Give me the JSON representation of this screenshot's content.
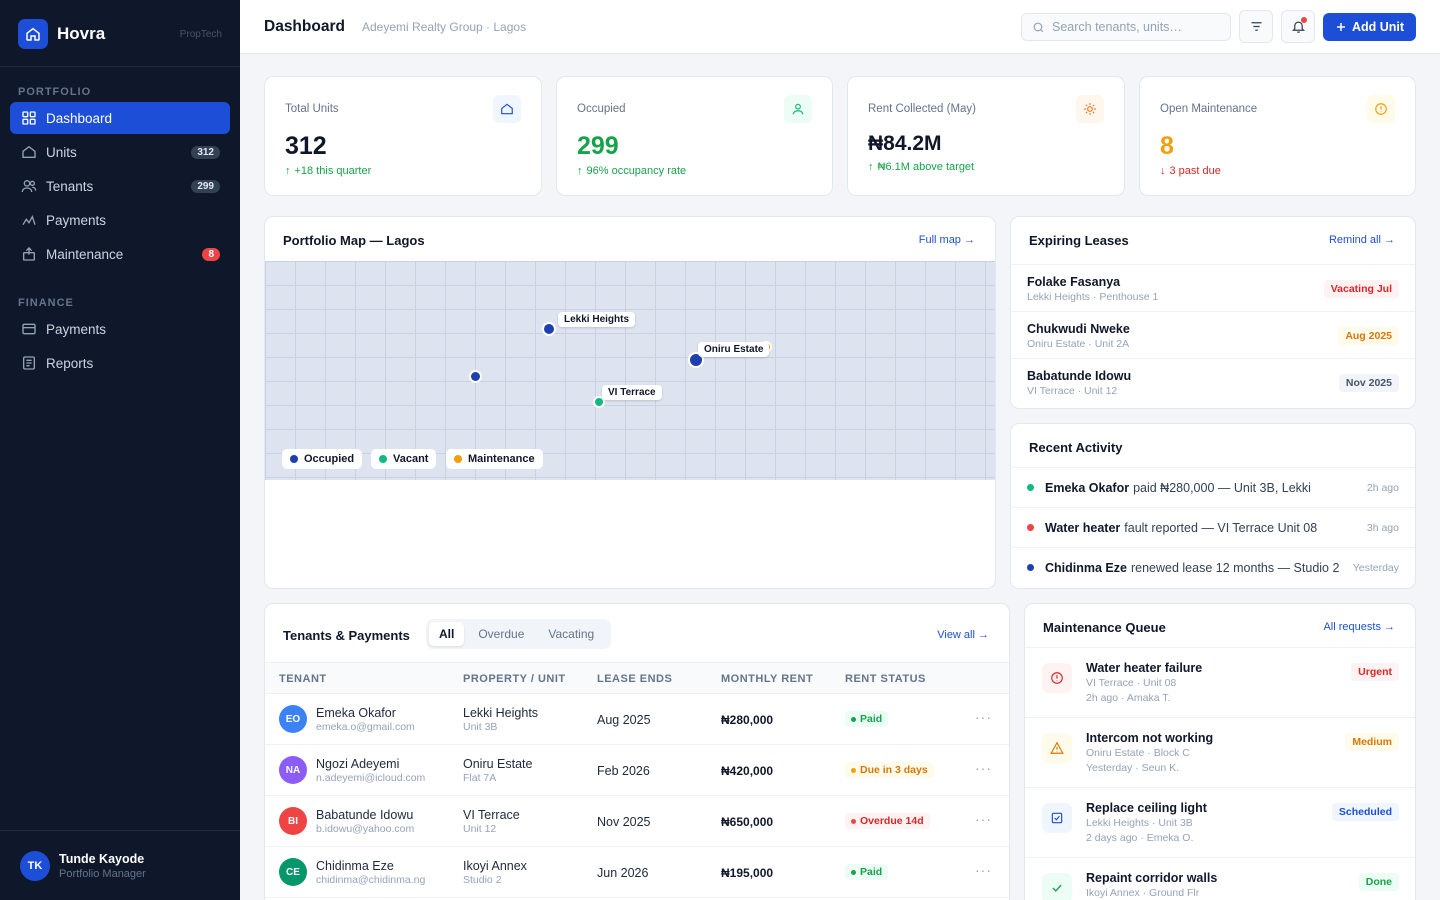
{
  "brand": {
    "name": "Hovra",
    "tag": "PropTech"
  },
  "sidebar": {
    "sections": [
      "PORTFOLIO",
      "FINANCE"
    ],
    "items": [
      {
        "label": "Dashboard",
        "icon": "grid-icon",
        "active": true
      },
      {
        "label": "Units",
        "icon": "home-icon",
        "badge": "312"
      },
      {
        "label": "Tenants",
        "icon": "users-icon",
        "badge": "299"
      },
      {
        "label": "Payments",
        "icon": "trend-icon"
      },
      {
        "label": "Maintenance",
        "icon": "toolbox-icon",
        "badge": "8"
      },
      {
        "label": "Payments",
        "icon": "card-icon"
      },
      {
        "label": "Reports",
        "icon": "report-icon"
      }
    ],
    "user": {
      "initials": "TK",
      "name": "Tunde Kayode",
      "role": "Portfolio Manager"
    }
  },
  "topbar": {
    "title": "Dashboard",
    "subtitle": "Adeyemi Realty Group · Lagos",
    "search_placeholder": "Search tenants, units…",
    "add_label": "Add Unit"
  },
  "stats": [
    {
      "label": "Total Units",
      "value": "312",
      "sub": "+18 this quarter",
      "color": "#0f172a",
      "sub_color": "#16a34a"
    },
    {
      "label": "Occupied",
      "value": "299",
      "sub": "96% occupancy rate",
      "color": "#16a34a",
      "sub_color": "#16a34a"
    },
    {
      "label": "Rent Collected (May)",
      "value": "₦84.2M",
      "sub": "₦6.1M above target",
      "color": "#0f172a",
      "sub_color": "#16a34a"
    },
    {
      "label": "Open Maintenance",
      "value": "8",
      "sub": "3 past due",
      "color": "#f59e0b",
      "sub_color": "#dc2626"
    }
  ],
  "map": {
    "title": "Portfolio Map — Lagos",
    "link": "Full map →",
    "labels": [
      "Lekki Heights",
      "Oniru Estate",
      "VI Terrace"
    ],
    "legend": [
      "Occupied",
      "Vacant",
      "Maintenance"
    ],
    "colors": {
      "occupied": "#1e40af",
      "vacant": "#10b981",
      "maintenance": "#f59e0b"
    }
  },
  "leases": {
    "title": "Expiring Leases",
    "link": "Remind all →",
    "items": [
      {
        "name": "Folake Fasanya",
        "sub": "Lekki Heights · Penthouse 1",
        "badge": "Vacating Jul"
      },
      {
        "name": "Chukwudi Nweke",
        "sub": "Oniru Estate · Unit 2A",
        "badge": "Aug 2025"
      },
      {
        "name": "Babatunde Idowu",
        "sub": "VI Terrace · Unit 12",
        "badge": "Nov 2025"
      }
    ]
  },
  "activity": {
    "title": "Recent Activity",
    "items": [
      {
        "who": "Emeka Okafor",
        "text": "paid ₦280,000 — Unit 3B, Lekki",
        "time": "2h ago"
      },
      {
        "who": "Water heater",
        "text": "fault reported — VI Terrace Unit 08",
        "time": "3h ago"
      },
      {
        "who": "Chidinma Eze",
        "text": "renewed lease 12 months — Studio 2",
        "time": "Yesterday"
      }
    ]
  },
  "tenants": {
    "title": "Tenants & Payments",
    "tabs": [
      "All",
      "Overdue",
      "Vacating"
    ],
    "link": "View all →",
    "columns": [
      "TENANT",
      "PROPERTY / UNIT",
      "LEASE ENDS",
      "MONTHLY RENT",
      "RENT STATUS"
    ],
    "rows": [
      {
        "initials": "EO",
        "name": "Emeka Okafor",
        "email": "emeka.o@gmail.com",
        "property": "Lekki Heights",
        "unit": "Unit 3B",
        "lease": "Aug 2025",
        "rent": "₦280,000",
        "status": "Paid"
      },
      {
        "initials": "NA",
        "name": "Ngozi Adeyemi",
        "email": "n.adeyemi@icloud.com",
        "property": "Oniru Estate",
        "unit": "Flat 7A",
        "lease": "Feb 2026",
        "rent": "₦420,000",
        "status": "Due in 3 days"
      },
      {
        "initials": "BI",
        "name": "Babatunde Idowu",
        "email": "b.idowu@yahoo.com",
        "property": "VI Terrace",
        "unit": "Unit 12",
        "lease": "Nov 2025",
        "rent": "₦650,000",
        "status": "Overdue 14d"
      },
      {
        "initials": "CE",
        "name": "Chidinma Eze",
        "email": "chidinma@chidinma.ng",
        "property": "Ikoyi Annex",
        "unit": "Studio 2",
        "lease": "Jun 2026",
        "rent": "₦195,000",
        "status": "Paid"
      }
    ],
    "more": "···"
  },
  "maintenance": {
    "title": "Maintenance Queue",
    "link": "All requests →",
    "items": [
      {
        "title": "Water heater failure",
        "sub": "VI Terrace · Unit 08",
        "meta": "2h ago · Amaka T.",
        "badge": "Urgent"
      },
      {
        "title": "Intercom not working",
        "sub": "Oniru Estate · Block C",
        "meta": "Yesterday · Seun K.",
        "badge": "Medium"
      },
      {
        "title": "Replace ceiling light",
        "sub": "Lekki Heights · Unit 3B",
        "meta": "2 days ago · Emeka O.",
        "badge": "Scheduled"
      },
      {
        "title": "Repaint corridor walls",
        "sub": "Ikoyi Annex · Ground Flr",
        "meta": "",
        "badge": "Done"
      }
    ]
  }
}
